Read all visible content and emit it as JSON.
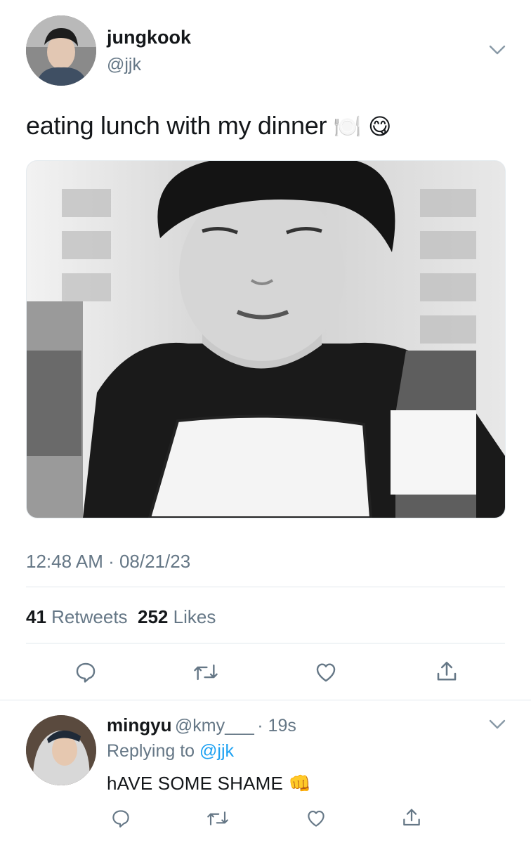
{
  "tweet": {
    "author_name": "jungkook",
    "author_handle": "@jjk",
    "text": "eating lunch with my dinner",
    "emoji_plate": "🍽️",
    "emoji_face": "😋",
    "timestamp": "12:48 AM · 08/21/23",
    "retweets_count": "41",
    "retweets_label": "Retweets",
    "likes_count": "252",
    "likes_label": "Likes",
    "icons": [
      "reply-icon",
      "retweet-icon",
      "like-icon",
      "share-icon"
    ]
  },
  "reply": {
    "author_name": "mingyu",
    "author_handle": "@kmy___",
    "time": "· 19s",
    "replying_prefix": "Replying to",
    "replying_to": "@jjk",
    "text": "hAVE SOME SHAME",
    "emoji": "👊",
    "icons": [
      "reply-icon",
      "retweet-icon",
      "like-icon",
      "share-icon"
    ]
  },
  "colors": {
    "text": "#14171a",
    "secondary": "#657786",
    "link": "#1da1f2",
    "divider": "#e1e8ed"
  }
}
